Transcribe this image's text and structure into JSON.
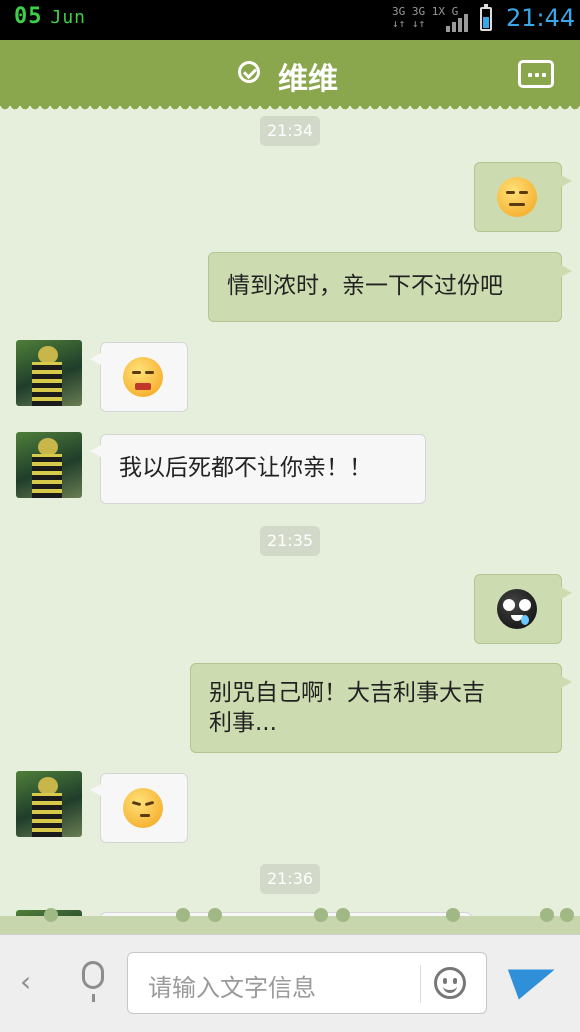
{
  "status": {
    "day": "05",
    "month": "Jun",
    "net_top": "3G 3G 1X G",
    "net_bottom": "↓↑ ↓↑",
    "time": "21:44"
  },
  "header": {
    "title": "维维"
  },
  "messages": [
    {
      "type": "time",
      "text": "21:34"
    },
    {
      "type": "out",
      "emoji": "smirk-emoji"
    },
    {
      "type": "out",
      "text": "情到浓时，亲一下不过份吧"
    },
    {
      "type": "in",
      "emoji": "crying-emoji"
    },
    {
      "type": "in",
      "text": "我以后死都不让你亲！！"
    },
    {
      "type": "time",
      "text": "21:35"
    },
    {
      "type": "out",
      "emoji": "black-sweat-emoji"
    },
    {
      "type": "out",
      "text_line1": "别咒自己啊！大吉利事大吉",
      "text_line2": "利事..."
    },
    {
      "type": "in",
      "emoji": "glare-emoji"
    },
    {
      "type": "time",
      "text": "21:36"
    }
  ],
  "input": {
    "placeholder": "请输入文字信息"
  },
  "colors": {
    "header": "#8aa74e",
    "outgoing_bubble": "#cddcb0",
    "incoming_bubble": "#f7f7f7",
    "chat_bg": "#e6eedc",
    "time_accent": "#3aa8e8"
  }
}
